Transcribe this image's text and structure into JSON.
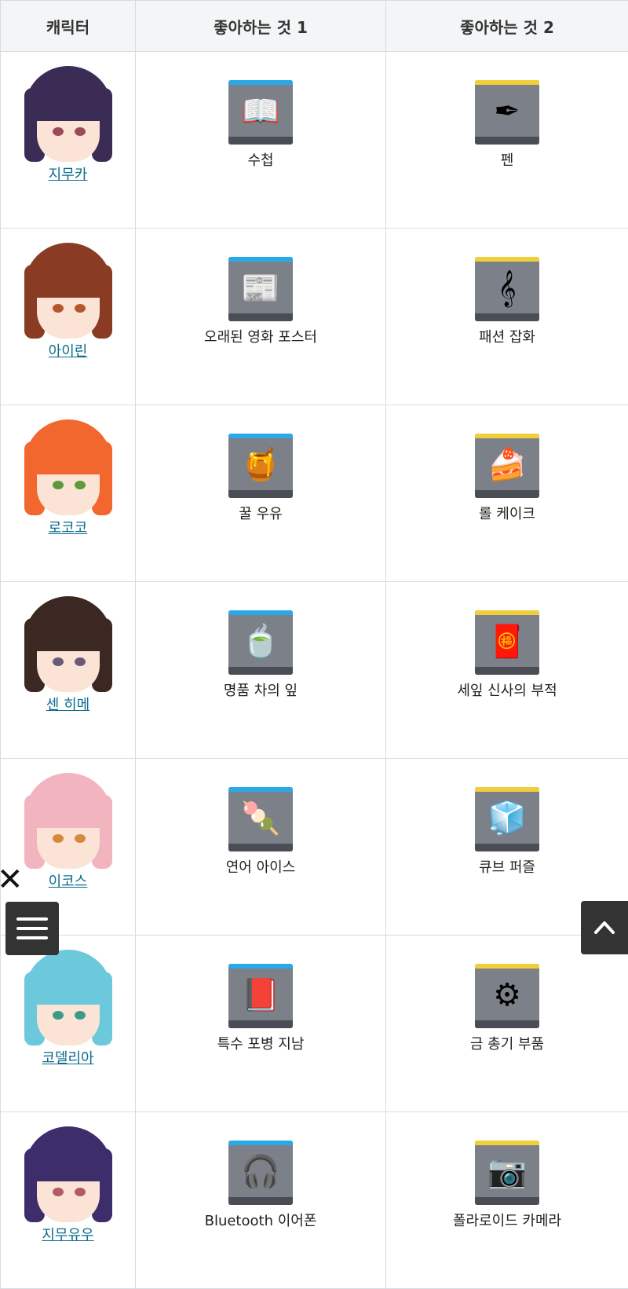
{
  "table": {
    "headers": [
      "캐릭터",
      "좋아하는 것 1",
      "좋아하는 것 2"
    ],
    "rows": [
      {
        "name": "지무카",
        "item1": "수첩",
        "item2": "펜",
        "icon1": "notebook-icon",
        "icon2": "fountain-pen-icon",
        "hair": "#3a2c55",
        "eye": "#9b4a5a"
      },
      {
        "name": "아이린",
        "item1": "오래된 영화 포스터",
        "item2": "패션 잡화",
        "icon1": "movie-poster-icon",
        "icon2": "fashion-accessory-icon",
        "hair": "#8a3b24",
        "eye": "#b4562f"
      },
      {
        "name": "로코코",
        "item1": "꿀 우유",
        "item2": "롤 케이크",
        "icon1": "honey-milk-icon",
        "icon2": "roll-cake-icon",
        "hair": "#f2672e",
        "eye": "#5c9a3c"
      },
      {
        "name": "센 히메",
        "item1": "명품 차의 잎",
        "item2": "세잎 신사의 부적",
        "icon1": "tea-leaves-icon",
        "icon2": "shrine-charm-icon",
        "hair": "#3b2822",
        "eye": "#6a5a7a"
      },
      {
        "name": "이코스",
        "item1": "연어 아이스",
        "item2": "큐브 퍼즐",
        "icon1": "salmon-ice-icon",
        "icon2": "cube-puzzle-icon",
        "hair": "#f2b4bf",
        "eye": "#d48a3a"
      },
      {
        "name": "코델리아",
        "item1": "특수 포병 지남",
        "item2": "금 총기 부품",
        "icon1": "guidebook-icon",
        "icon2": "gun-part-icon",
        "hair": "#6cc9dc",
        "eye": "#3d9a8a"
      },
      {
        "name": "지무유우",
        "item1": "Bluetooth 이어폰",
        "item2": "폴라로이드 카메라",
        "icon1": "bluetooth-earphone-icon",
        "icon2": "polaroid-camera-icon",
        "hair": "#3d2d6a",
        "eye": "#b25a6a"
      }
    ]
  },
  "glyphs": {
    "notebook-icon": "📖",
    "fountain-pen-icon": "✒",
    "movie-poster-icon": "📰",
    "fashion-accessory-icon": "𝄞",
    "honey-milk-icon": "🍯",
    "roll-cake-icon": "🍰",
    "tea-leaves-icon": "🍵",
    "shrine-charm-icon": "🧧",
    "salmon-ice-icon": "🍡",
    "cube-puzzle-icon": "🧊",
    "guidebook-icon": "📕",
    "gun-part-icon": "⚙",
    "bluetooth-earphone-icon": "🎧",
    "polaroid-camera-icon": "📷"
  },
  "colors": {
    "item1_bar": "#2aa9e8",
    "item2_bar": "#f0cf3a",
    "link": "#0a6d8a"
  }
}
